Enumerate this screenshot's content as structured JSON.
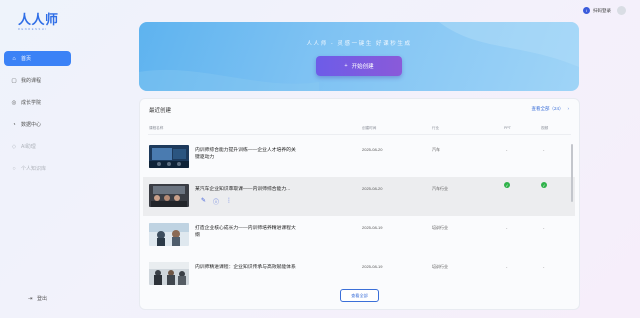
{
  "brand": {
    "logo": "人人师",
    "tagline": "RENRENSHI"
  },
  "topbar": {
    "login_label": "扫码登录",
    "login_icon": "i"
  },
  "sidebar": {
    "items": [
      {
        "label": "首页",
        "icon": "home-icon",
        "glyph": "⌂",
        "active": true,
        "disabled": false
      },
      {
        "label": "我的课程",
        "icon": "book-icon",
        "glyph": "▢",
        "active": false,
        "disabled": false
      },
      {
        "label": "成长学院",
        "icon": "growth-icon",
        "glyph": "◎",
        "active": false,
        "disabled": false
      },
      {
        "label": "数据中心",
        "icon": "data-icon",
        "glyph": "◔",
        "active": false,
        "disabled": false
      },
      {
        "label": "AI助理",
        "icon": "ai-icon",
        "glyph": "◇",
        "active": false,
        "disabled": true
      },
      {
        "label": "个人知识库",
        "icon": "knowledge-icon",
        "glyph": "○",
        "active": false,
        "disabled": true
      }
    ],
    "logout_label": "登出",
    "logout_glyph": "⇥"
  },
  "banner": {
    "slogan": "人人师 - 灵感一键生 好课秒生成",
    "create_label": "开始创建",
    "create_glyph": "+"
  },
  "recent": {
    "title": "最近创建",
    "view_all_top": "查看全部（24）",
    "view_all_top_glyph": "›",
    "columns": {
      "name": "课程名称",
      "date": "创建时间",
      "industry": "行业",
      "ppt": "PPT",
      "video": "视频"
    },
    "rows": [
      {
        "title": "内训师综合能力提升训练——企业人才培养的关键驱动力",
        "date": "2025-08-20",
        "industry": "汽车",
        "ppt": "-",
        "video": "-",
        "ppt_done": false,
        "video_done": false
      },
      {
        "title": "某汽车企业知识萃取课——内训师综合能力...",
        "date": "2025-08-20",
        "industry": "汽车行业",
        "ppt": "",
        "video": "",
        "ppt_done": true,
        "video_done": true
      },
      {
        "title": "打造企业核心成长力——内训师培养精进课程大纲",
        "date": "2025-08-19",
        "industry": "培训行业",
        "ppt": "-",
        "video": "-",
        "ppt_done": false,
        "video_done": false
      },
      {
        "title": "内训师精进课程：企业知识传承与高效赋能体系",
        "date": "2025-08-19",
        "industry": "培训行业",
        "ppt": "-",
        "video": "-",
        "ppt_done": false,
        "video_done": false
      }
    ],
    "row_actions": {
      "edit_glyph": "✎",
      "info_glyph": "ⓘ",
      "more_glyph": "⋮"
    },
    "view_all_button": "查看全部"
  }
}
